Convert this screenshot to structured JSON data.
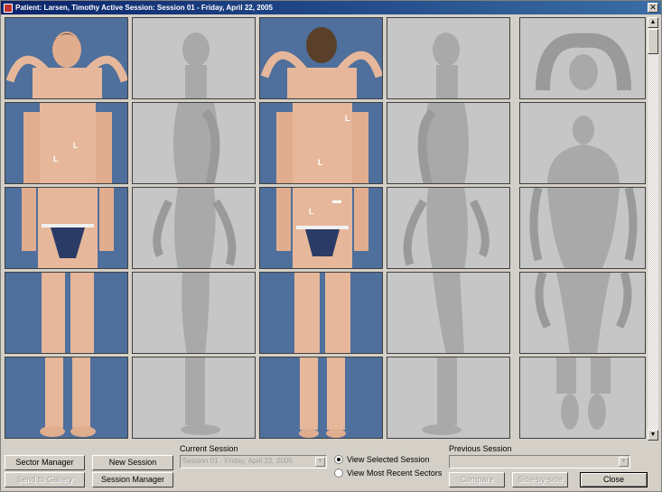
{
  "window": {
    "title": "Patient: Larsen, Timothy   Active Session: Session 01 - Friday, April 22, 2005",
    "close_glyph": "✕"
  },
  "markers": [
    "L",
    "L",
    "L",
    "L",
    "L"
  ],
  "buttons": {
    "sector_manager": "Sector Manager",
    "new_session": "New Session",
    "send_to_gallery": "Send to Gallery",
    "session_manager": "Session Manager",
    "compare": "Compare",
    "side_by_side": "Side-by-side",
    "close": "Close"
  },
  "current_session": {
    "label": "Current Session",
    "value": "Session 01 - Friday, April 22, 2005"
  },
  "view_options": {
    "selected": "View Selected Session",
    "recent": "View Most Recent Sectors"
  },
  "previous_session": {
    "label": "Previous Session",
    "value": ""
  },
  "colors": {
    "photo_bg": "#4f6f9c",
    "model_bg": "#c6c6c6",
    "title_start": "#0a246a",
    "title_end": "#3a6ea5"
  },
  "icons": {
    "app": "app-icon",
    "close": "close-icon",
    "scroll_up": "scroll-up-icon",
    "scroll_down": "scroll-down-icon",
    "dropdown": "chevron-down-icon"
  }
}
